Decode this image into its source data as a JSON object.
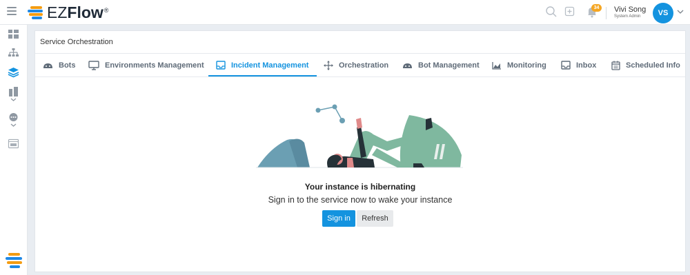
{
  "app": {
    "logo_prefix": "EZ",
    "logo_suffix": "Flow",
    "logo_mark": "®"
  },
  "header": {
    "notification_count": "34",
    "user_name": "Vivi Song",
    "user_role": "System Admin",
    "avatar_initials": "VS",
    "icons": [
      "menu-icon",
      "search-icon",
      "add-icon",
      "bell-icon",
      "chevron-down-icon"
    ]
  },
  "sidebar": {
    "icons": [
      "dashboard-icon",
      "hierarchy-icon",
      "layers-icon",
      "building-icon",
      "chat-icon",
      "terminal-icon",
      "ezflow-logo-icon"
    ],
    "active": "layers-icon"
  },
  "panel": {
    "title": "Service Orchestration"
  },
  "tabs": [
    {
      "label": "Bots",
      "icon": "bot-icon"
    },
    {
      "label": "Environments Management",
      "icon": "monitor-icon"
    },
    {
      "label": "Incident Management",
      "icon": "inbox-icon",
      "active": true
    },
    {
      "label": "Orchestration",
      "icon": "move-icon"
    },
    {
      "label": "Bot Management",
      "icon": "bot-icon"
    },
    {
      "label": "Monitoring",
      "icon": "chart-icon"
    },
    {
      "label": "Inbox",
      "icon": "inbox-icon"
    },
    {
      "label": "Scheduled Info",
      "icon": "calendar-icon"
    }
  ],
  "message": {
    "title": "Your instance is hibernating",
    "subtitle": "Sign in to the service now to wake your instance",
    "signin_label": "Sign in",
    "refresh_label": "Refresh"
  },
  "colors": {
    "accent": "#1493df",
    "badge": "#f5a623",
    "illustration_teal": "#6b9fb3",
    "illustration_green": "#7fb89f",
    "illustration_skin": "#e08a8a",
    "illustration_dark": "#263238"
  }
}
